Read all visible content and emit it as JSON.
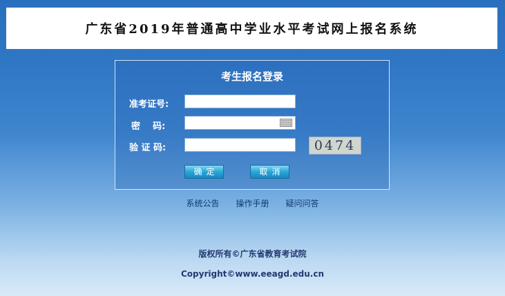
{
  "header": {
    "title": "广东省2019年普通高中学业水平考试网上报名系统"
  },
  "login": {
    "title": "考生报名登录",
    "exam_id_label": "准考证号:",
    "password_label": "密    码:",
    "captcha_label": "验 证 码:",
    "exam_id_value": "",
    "password_value": "",
    "captcha_value": "",
    "captcha_text": "0474",
    "confirm_label": "确定",
    "cancel_label": "取消"
  },
  "links": {
    "system_notice": "系统公告",
    "manual": "操作手册",
    "faq": "疑问问答"
  },
  "footer": {
    "copyright": "版权所有©广东省教育考试院",
    "url": "Copyright©www.eeagd.edu.cn"
  }
}
